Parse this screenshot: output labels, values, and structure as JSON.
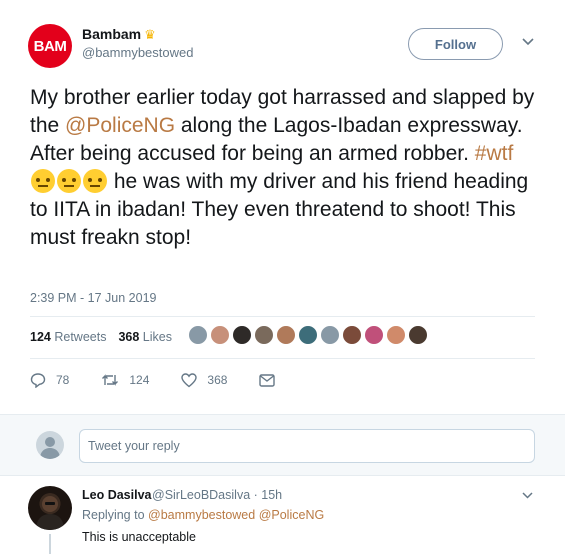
{
  "tweet": {
    "avatar_text": "BAM",
    "display_name": "Bambam",
    "crown_glyph": "♛",
    "handle": "@bammybestowed",
    "follow_label": "Follow",
    "body_1": "My brother earlier today got harrassed and slapped by the ",
    "mention": "@PoliceNG",
    "body_2": " along the Lagos-Ibadan expressway. After being accused for being an armed robber. ",
    "hashtag": "#wtf",
    "body_3": " he was with my driver and his friend heading to IITA in ibadan! They even threatend to shoot! This must freakn stop!",
    "timestamp": "2:39 PM - 17 Jun 2019",
    "retweets_count": "124",
    "retweets_label": "Retweets",
    "likes_count": "368",
    "likes_label": "Likes",
    "actions": {
      "reply_count": "78",
      "retweet_count": "124",
      "like_count": "368"
    },
    "face_colors": [
      "#8899a6",
      "#c7907a",
      "#2e2a28",
      "#7a6a5c",
      "#b07a5a",
      "#3d6d7a",
      "#8899a6",
      "#7b4b3a",
      "#c0507a",
      "#d08a6a",
      "#4a3a30"
    ]
  },
  "reply_box": {
    "placeholder": "Tweet your reply"
  },
  "reply": {
    "name": "Leo Dasilva",
    "meta": "@SirLeoBDasilva · 15h",
    "replying_to_label": "Replying to",
    "replying_to_1": "@bammybestowed",
    "replying_to_2": "@PoliceNG",
    "text": "This is unacceptable"
  },
  "colors": {
    "accent": "#b97a44",
    "brand_red": "#e3001b"
  }
}
